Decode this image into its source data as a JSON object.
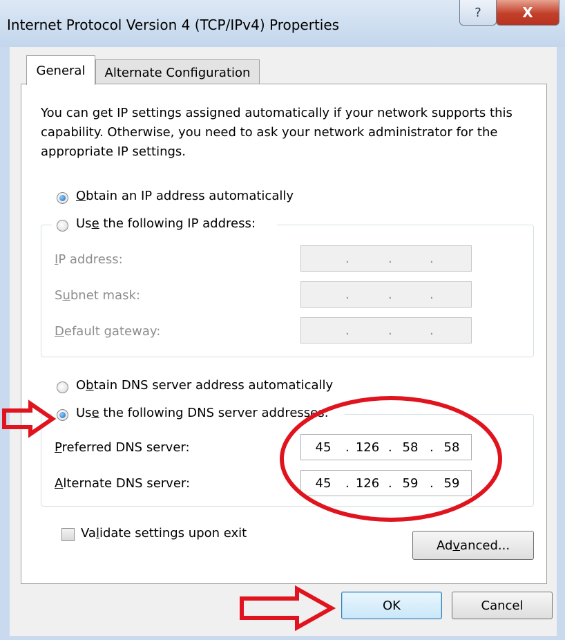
{
  "window": {
    "title": "Internet Protocol Version 4 (TCP/IPv4) Properties",
    "help_glyph": "?",
    "close_glyph": "X"
  },
  "tabs": [
    {
      "label": "General",
      "selected": true
    },
    {
      "label": "Alternate Configuration",
      "selected": false
    }
  ],
  "description": "You can get IP settings assigned automatically if your network supports this capability. Otherwise, you need to ask your network administrator for the appropriate IP settings.",
  "ip": {
    "auto_label_pre": "",
    "auto_label_u": "O",
    "auto_label_post": "btain an IP address automatically",
    "manual_label_pre": "Us",
    "manual_label_u": "e",
    "manual_label_post": " the following IP address:",
    "ip_label_pre": "",
    "ip_label_u": "I",
    "ip_label_post": "P address:",
    "subnet_label_pre": "S",
    "subnet_label_u": "u",
    "subnet_label_post": "bnet mask:",
    "gateway_label_pre": "",
    "gateway_label_u": "D",
    "gateway_label_post": "efault gateway:",
    "selected": "auto"
  },
  "dns": {
    "auto_label_pre": "O",
    "auto_label_u": "b",
    "auto_label_post": "tain DNS server address automatically",
    "manual_label_pre": "Us",
    "manual_label_u": "e",
    "manual_label_post": " the following DNS server addresses:",
    "preferred_label_pre": "",
    "preferred_label_u": "P",
    "preferred_label_post": "referred DNS server:",
    "alternate_label_pre": "",
    "alternate_label_u": "A",
    "alternate_label_post": "lternate DNS server:",
    "preferred": [
      "45",
      "126",
      "58",
      "58"
    ],
    "alternate": [
      "45",
      "126",
      "59",
      "59"
    ],
    "selected": "manual"
  },
  "validate": {
    "label_pre": "Va",
    "label_u": "l",
    "label_post": "idate settings upon exit",
    "checked": false
  },
  "buttons": {
    "advanced_pre": "Ad",
    "advanced_u": "v",
    "advanced_post": "anced...",
    "ok": "OK",
    "cancel": "Cancel"
  },
  "colors": {
    "annotation": "#e0141e",
    "title_bar": "#c9daee",
    "close_button": "#c2402a"
  }
}
